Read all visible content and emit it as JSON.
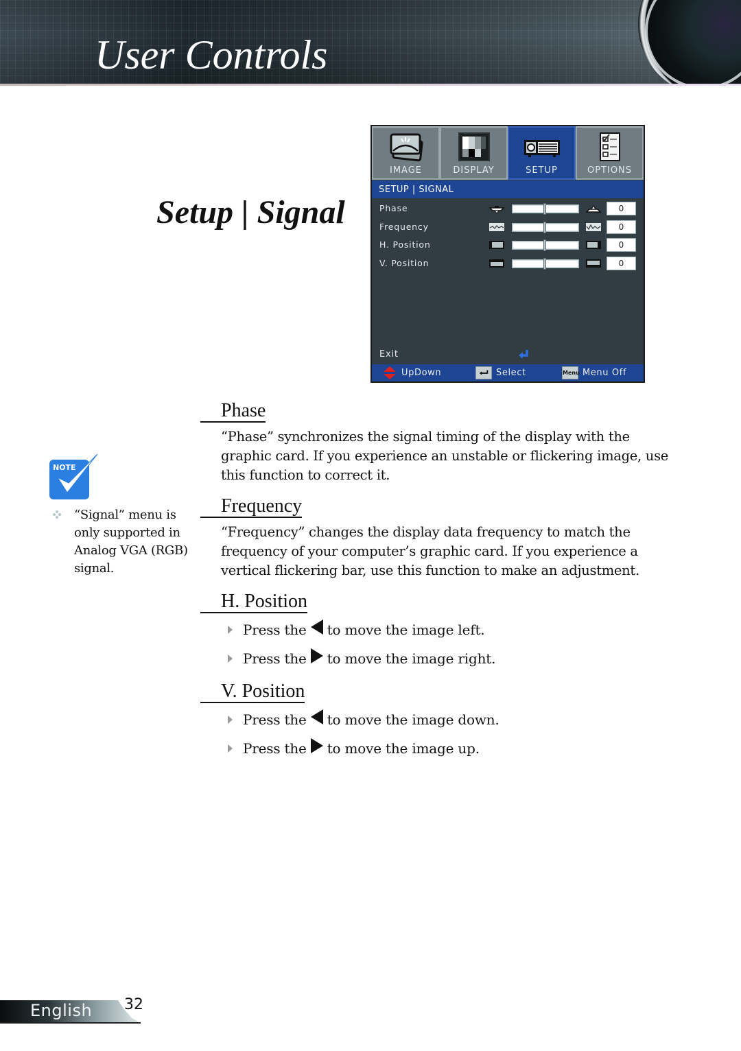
{
  "header": {
    "title": "User Controls"
  },
  "section": {
    "title": "Setup | Signal"
  },
  "osd": {
    "tabs": [
      {
        "label": "IMAGE",
        "icon": "image-icon",
        "active": false
      },
      {
        "label": "DISPLAY",
        "icon": "display-icon",
        "active": false
      },
      {
        "label": "SETUP",
        "icon": "projector-icon",
        "active": true
      },
      {
        "label": "OPTIONS",
        "icon": "checklist-icon",
        "active": false
      }
    ],
    "breadcrumb": "SETUP | SIGNAL",
    "rows": [
      {
        "name": "Phase",
        "value": "0",
        "slider_fraction": 0.5,
        "left_icon": "phase-low-icon",
        "right_icon": "phase-high-icon"
      },
      {
        "name": "Frequency",
        "value": "0",
        "slider_fraction": 0.5,
        "left_icon": "frequency-low-icon",
        "right_icon": "frequency-high-icon"
      },
      {
        "name": "H. Position",
        "value": "0",
        "slider_fraction": 0.5,
        "left_icon": "h-position-left-icon",
        "right_icon": "h-position-right-icon"
      },
      {
        "name": "V. Position",
        "value": "0",
        "slider_fraction": 0.5,
        "left_icon": "v-position-down-icon",
        "right_icon": "v-position-up-icon"
      }
    ],
    "exit_label": "Exit",
    "footer": {
      "updown_label": "UpDown",
      "select_label": "Select",
      "menu_key": "Menu",
      "menu_off_label": "Menu Off"
    },
    "colors": {
      "background": "#313c43",
      "accent": "#1e4594",
      "tab": "#6f7d82",
      "enter_arrow": "#2f6fe0",
      "updown_arrow": "#e02020"
    }
  },
  "note": {
    "badge": "Note",
    "text": "“Signal” menu is only supported in Analog VGA (RGB) signal.",
    "badge_color": "#2b7fe0"
  },
  "content": {
    "phase": {
      "heading": "Phase",
      "text": "“Phase” synchronizes the signal timing of the display with the graphic card. If you experience an unstable or flickering image, use this function to correct it."
    },
    "frequency": {
      "heading": "Frequency",
      "text": "“Frequency” changes the display data frequency to match the frequency of your computer’s graphic card. If you experience a vertical flickering bar, use this function to make an adjustment."
    },
    "h_position": {
      "heading": "H. Position",
      "bullets": [
        {
          "prefix": "Press the",
          "key": "left",
          "suffix": "to move the image left."
        },
        {
          "prefix": "Press the",
          "key": "right",
          "suffix": "to move the image right."
        }
      ]
    },
    "v_position": {
      "heading": "V. Position",
      "bullets": [
        {
          "prefix": "Press the",
          "key": "left",
          "suffix": "to move the image down."
        },
        {
          "prefix": "Press the",
          "key": "right",
          "suffix": "to move the image up."
        }
      ]
    }
  },
  "footer": {
    "language": "English",
    "page_number": "32"
  }
}
